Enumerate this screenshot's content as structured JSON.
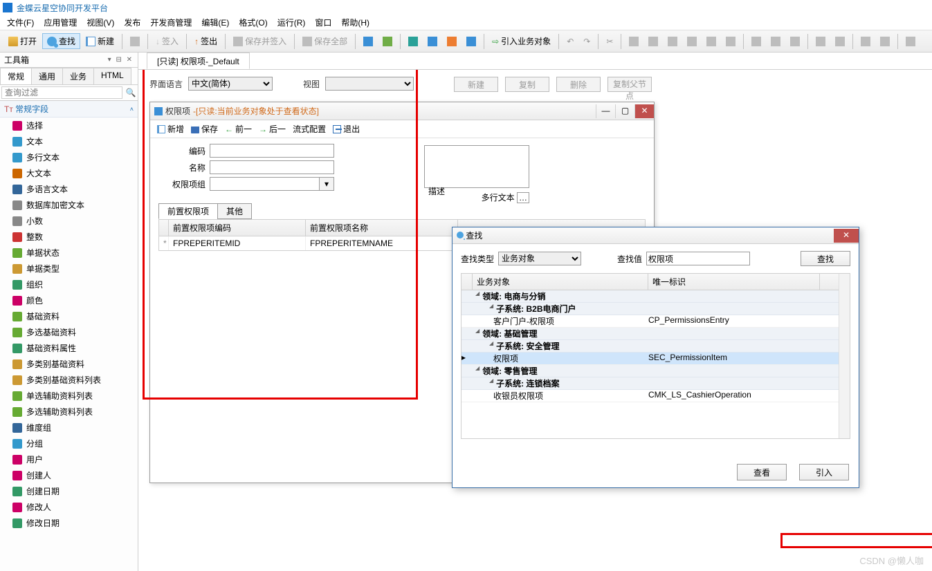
{
  "app": {
    "title": "金蝶云星空协同开发平台"
  },
  "menubar": [
    "文件(F)",
    "应用管理",
    "视图(V)",
    "发布",
    "开发商管理",
    "编辑(E)",
    "格式(O)",
    "运行(R)",
    "窗口",
    "帮助(H)"
  ],
  "toolbar": {
    "open": "打开",
    "search": "查找",
    "new": "新建",
    "checkin": "签入",
    "checkout": "签出",
    "savecheckin": "保存并签入",
    "saveall": "保存全部",
    "import": "引入业务对象"
  },
  "left": {
    "title": "工具箱",
    "tabs": [
      "常规",
      "通用",
      "业务",
      "HTML"
    ],
    "filter_placeholder": "查询过滤",
    "section": "常规字段",
    "items": [
      "选择",
      "文本",
      "多行文本",
      "大文本",
      "多语言文本",
      "数据库加密文本",
      "小数",
      "整数",
      "单据状态",
      "单据类型",
      "组织",
      "颜色",
      "基础资料",
      "多选基础资料",
      "基础资料属性",
      "多类别基础资料",
      "多类别基础资料列表",
      "单选辅助资料列表",
      "多选辅助资料列表",
      "维度组",
      "分组",
      "用户",
      "创建人",
      "创建日期",
      "修改人",
      "修改日期"
    ]
  },
  "doc_tab": "[只读] 权限项-_Default",
  "formbar": {
    "lang_label": "界面语言",
    "lang_value": "中文(简体)",
    "view_label": "视图",
    "view_value": ""
  },
  "top_buttons": [
    "新建",
    "复制",
    "删除",
    "复制父节点"
  ],
  "win": {
    "title": "权限项",
    "readonly": "-[只读:当前业务对象处于查看状态]",
    "tb": [
      "新增",
      "保存",
      "前一",
      "后一",
      "流式配置",
      "退出"
    ],
    "fields": {
      "code": "编码",
      "name": "名称",
      "group": "权限项组",
      "desc": "描述",
      "multiline": "多行文本"
    },
    "tabs": [
      "前置权限项",
      "其他"
    ],
    "grid_headers": [
      "前置权限项编码",
      "前置权限项名称"
    ],
    "grid_row": [
      "FPREPERITEMID",
      "FPREPERITEMNAME"
    ]
  },
  "dlg": {
    "title": "查找",
    "type_label": "查找类型",
    "type_value": "业务对象",
    "val_label": "查找值",
    "val_value": "权限项",
    "find_btn": "查找",
    "headers": [
      "业务对象",
      "唯一标识"
    ],
    "rows": [
      {
        "kind": "group",
        "depth": 1,
        "label": "领域: 电商与分销"
      },
      {
        "kind": "group",
        "depth": 2,
        "label": "子系统: B2B电商门户"
      },
      {
        "kind": "item",
        "a": "客户门户-权限项",
        "b": "CP_PermissionsEntry"
      },
      {
        "kind": "group",
        "depth": 1,
        "label": "领域: 基础管理"
      },
      {
        "kind": "group",
        "depth": 2,
        "label": "子系统: 安全管理"
      },
      {
        "kind": "item",
        "a": "权限项",
        "b": "SEC_PermissionItem",
        "sel": true
      },
      {
        "kind": "group",
        "depth": 1,
        "label": "领域: 零售管理"
      },
      {
        "kind": "group",
        "depth": 2,
        "label": "子系统: 连锁档案"
      },
      {
        "kind": "item",
        "a": "收银员权限项",
        "b": "CMK_LS_CashierOperation"
      }
    ],
    "foot": [
      "查看",
      "引入"
    ]
  },
  "watermark": "CSDN @懒人咖"
}
